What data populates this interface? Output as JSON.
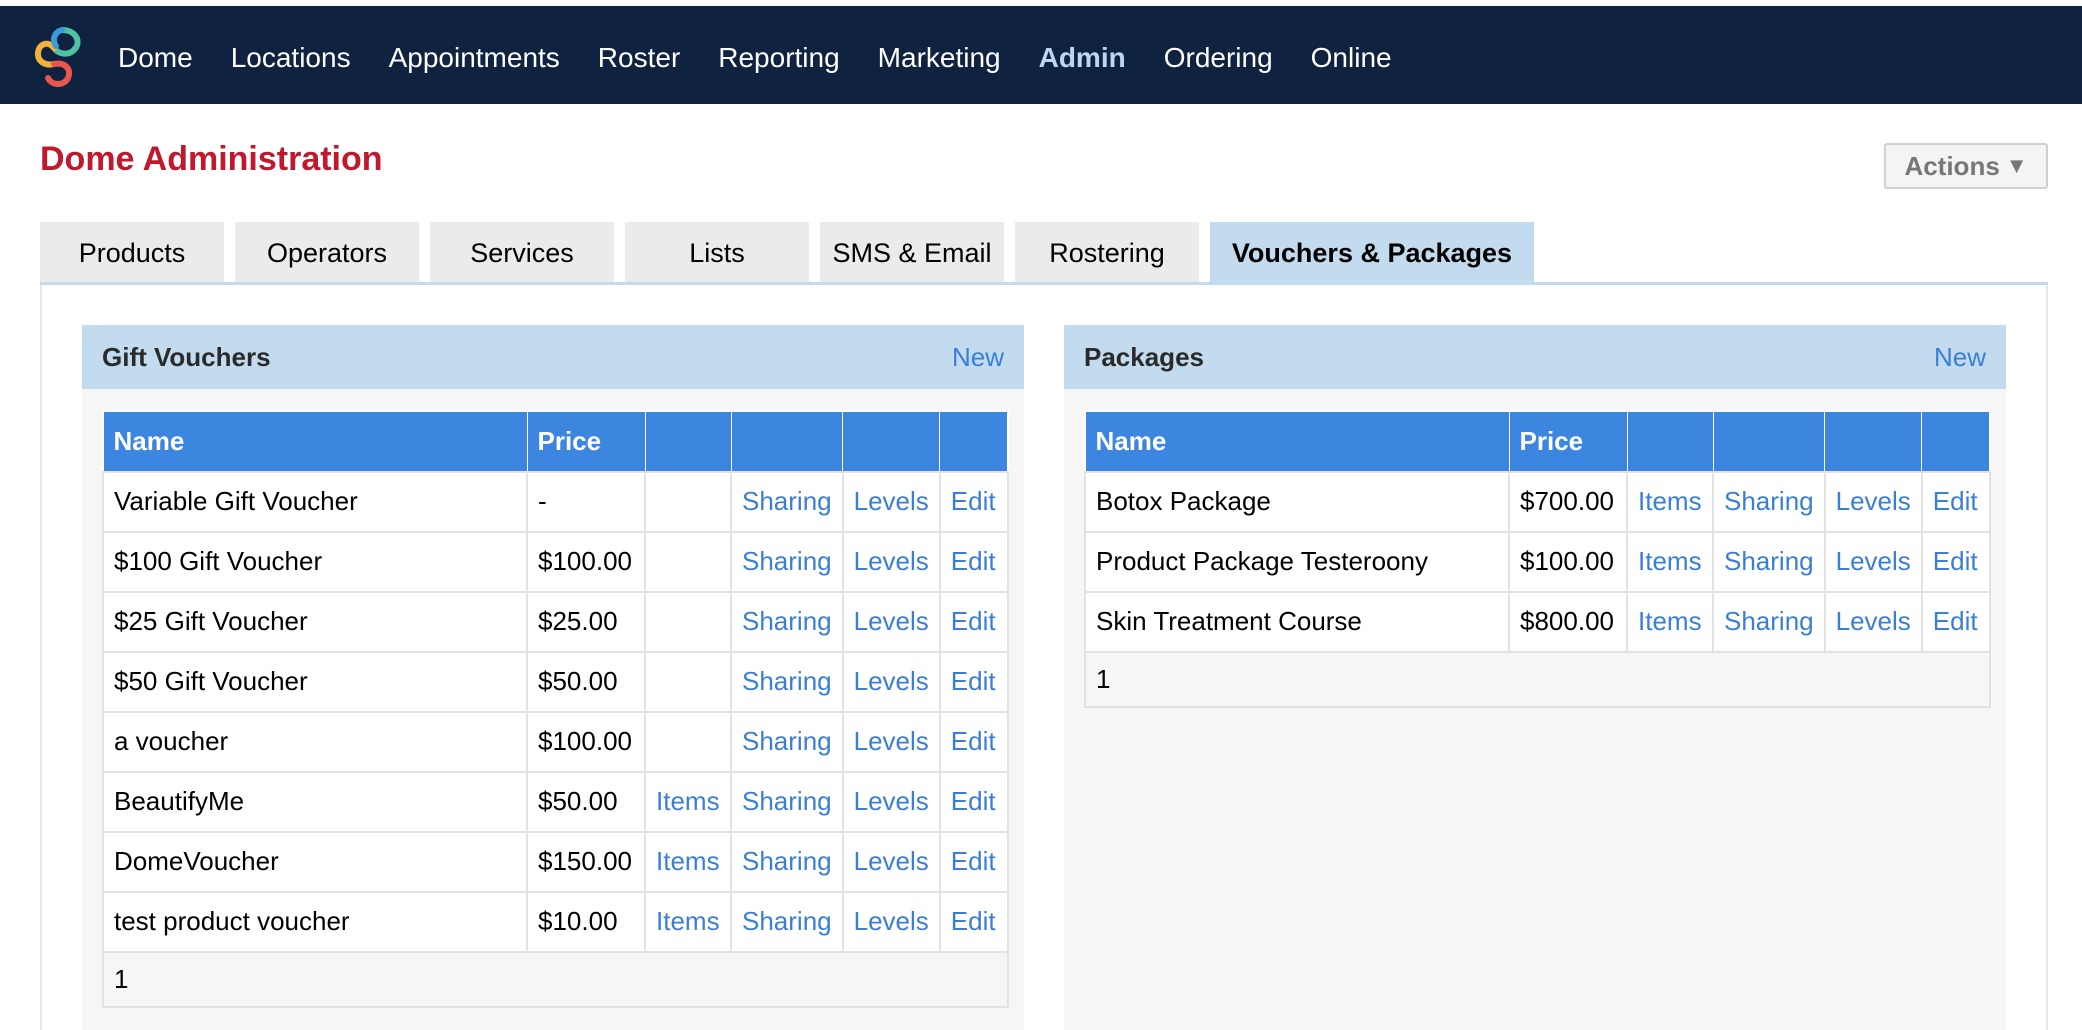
{
  "nav": {
    "items": [
      "Dome",
      "Locations",
      "Appointments",
      "Roster",
      "Reporting",
      "Marketing",
      "Admin",
      "Ordering",
      "Online"
    ],
    "active": "Admin"
  },
  "page": {
    "title": "Dome Administration",
    "actions_label": "Actions",
    "actions_caret": "▼"
  },
  "tabs": [
    {
      "label": "Products"
    },
    {
      "label": "Operators"
    },
    {
      "label": "Services"
    },
    {
      "label": "Lists"
    },
    {
      "label": "SMS & Email"
    },
    {
      "label": "Rostering"
    },
    {
      "label": "Vouchers & Packages",
      "active": true
    }
  ],
  "gift": {
    "title": "Gift Vouchers",
    "new_label": "New",
    "headers": [
      "Name",
      "Price",
      "",
      "",
      "",
      ""
    ],
    "rows": [
      {
        "name": "Variable Gift Voucher",
        "price": "-",
        "items": "",
        "sharing": "Sharing",
        "levels": "Levels",
        "edit": "Edit"
      },
      {
        "name": "$100 Gift Voucher",
        "price": "$100.00",
        "items": "",
        "sharing": "Sharing",
        "levels": "Levels",
        "edit": "Edit"
      },
      {
        "name": "$25 Gift Voucher",
        "price": "$25.00",
        "items": "",
        "sharing": "Sharing",
        "levels": "Levels",
        "edit": "Edit"
      },
      {
        "name": "$50 Gift Voucher",
        "price": "$50.00",
        "items": "",
        "sharing": "Sharing",
        "levels": "Levels",
        "edit": "Edit"
      },
      {
        "name": "a voucher",
        "price": "$100.00",
        "items": "",
        "sharing": "Sharing",
        "levels": "Levels",
        "edit": "Edit"
      },
      {
        "name": "BeautifyMe",
        "price": "$50.00",
        "items": "Items",
        "sharing": "Sharing",
        "levels": "Levels",
        "edit": "Edit"
      },
      {
        "name": "DomeVoucher",
        "price": "$150.00",
        "items": "Items",
        "sharing": "Sharing",
        "levels": "Levels",
        "edit": "Edit"
      },
      {
        "name": "test product voucher",
        "price": "$10.00",
        "items": "Items",
        "sharing": "Sharing",
        "levels": "Levels",
        "edit": "Edit"
      }
    ],
    "page": "1"
  },
  "packages": {
    "title": "Packages",
    "new_label": "New",
    "headers": [
      "Name",
      "Price",
      "",
      "",
      "",
      ""
    ],
    "rows": [
      {
        "name": "Botox Package",
        "price": "$700.00",
        "items": "Items",
        "sharing": "Sharing",
        "levels": "Levels",
        "edit": "Edit"
      },
      {
        "name": "Product Package Testeroony",
        "price": "$100.00",
        "items": "Items",
        "sharing": "Sharing",
        "levels": "Levels",
        "edit": "Edit"
      },
      {
        "name": "Skin Treatment Course",
        "price": "$800.00",
        "items": "Items",
        "sharing": "Sharing",
        "levels": "Levels",
        "edit": "Edit"
      }
    ],
    "page": "1"
  },
  "colors": {
    "nav_bg": "#0f2340",
    "title_red": "#c0182c",
    "link_blue": "#3a7fd5",
    "header_blue": "#3d86e0",
    "panel_head": "#c2dbee"
  },
  "icons": {
    "logo": "dome-logo-icon"
  }
}
